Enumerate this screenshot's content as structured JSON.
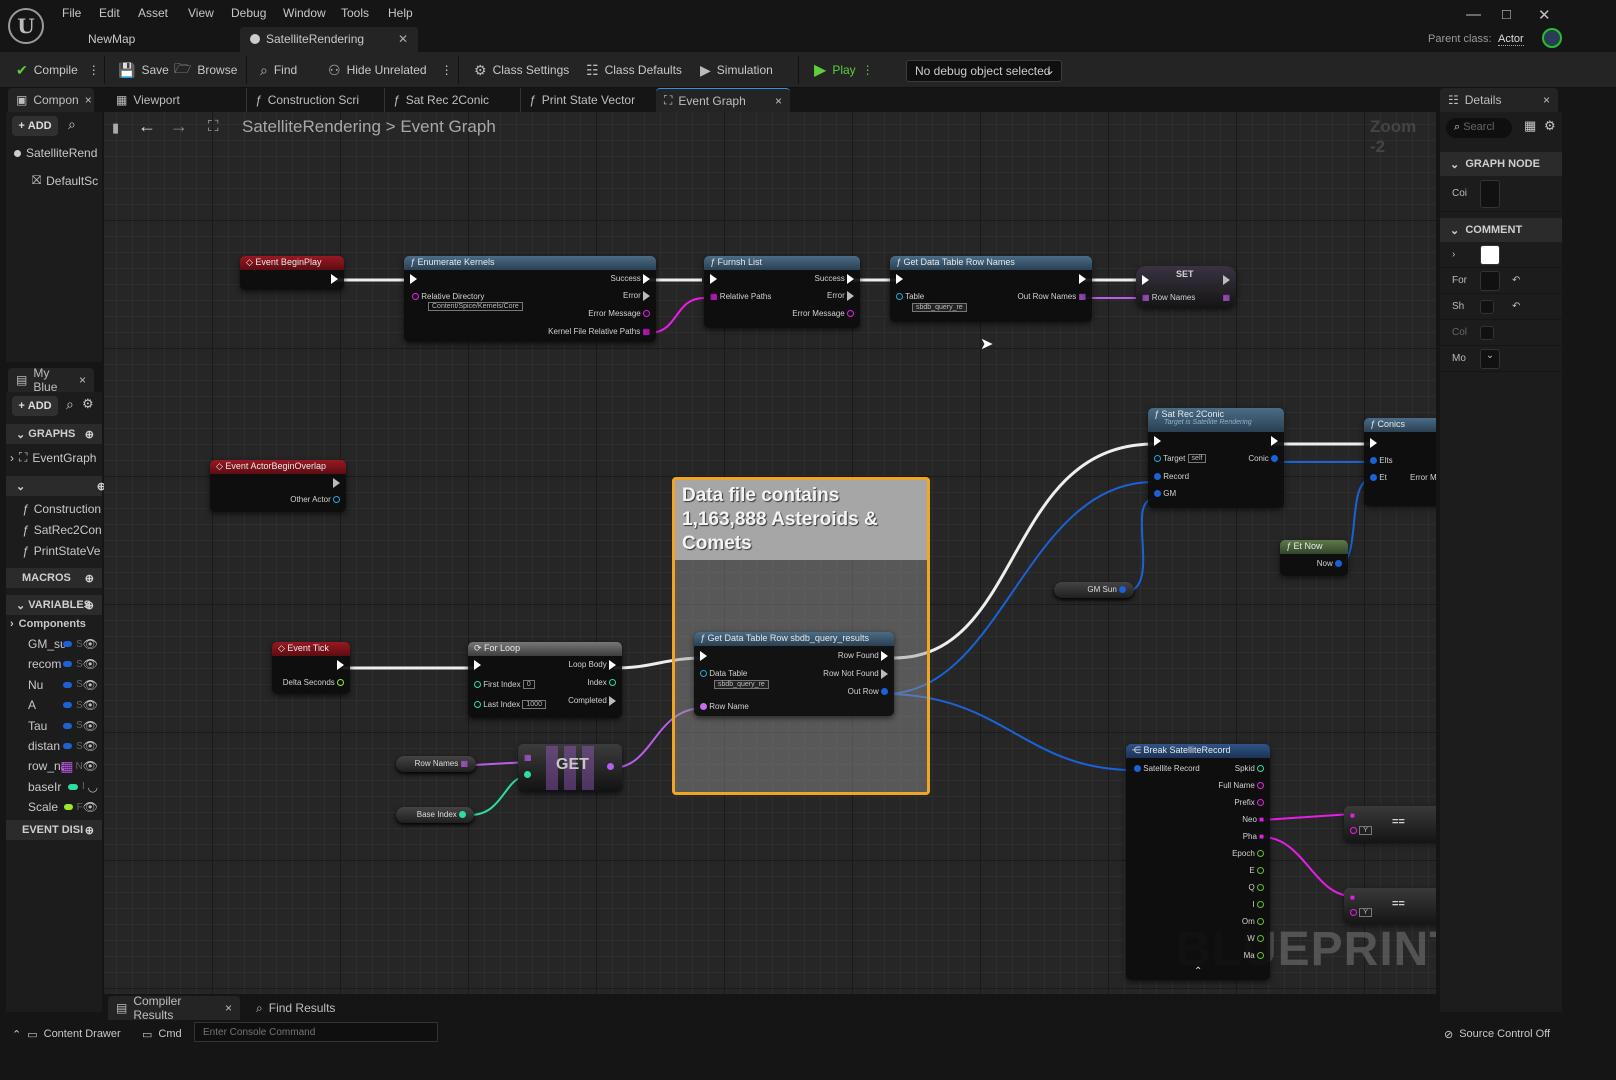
{
  "app": {
    "menu": [
      "File",
      "Edit",
      "Asset",
      "View",
      "Debug",
      "Window",
      "Tools",
      "Help"
    ],
    "doc_tabs": [
      {
        "label": "NewMap",
        "active": false
      },
      {
        "label": "SatelliteRendering",
        "active": true
      }
    ],
    "parent_class_label": "Parent class:",
    "parent_class_value": "Actor",
    "window_controls": {
      "minimize": "—",
      "maximize": "□",
      "close": "✕"
    }
  },
  "toolbar": {
    "compile": "Compile",
    "save": "Save",
    "browse": "Browse",
    "find": "Find",
    "hide_unrelated": "Hide Unrelated",
    "class_settings": "Class Settings",
    "class_defaults": "Class Defaults",
    "simulation": "Simulation",
    "play": "Play",
    "debug_object": "No debug object selected",
    "accent_play": "#5fcd3d"
  },
  "components_panel": {
    "tab": "Compon",
    "add": "ADD",
    "items": [
      "SatelliteRend",
      "DefaultSc"
    ]
  },
  "graph_tabs": [
    {
      "label": "Viewport",
      "icon": "viewport-icon"
    },
    {
      "label": "Construction Scri",
      "icon": "function-icon"
    },
    {
      "label": "Sat Rec 2Conic",
      "icon": "function-icon"
    },
    {
      "label": "Print State Vector",
      "icon": "function-icon"
    },
    {
      "label": "Event Graph",
      "icon": "graph-icon",
      "active": true
    }
  ],
  "breadcrumb": {
    "root": "SatelliteRendering",
    "sep": ">",
    "current": "Event Graph"
  },
  "zoom_label": "Zoom -2",
  "watermark": "BLUEPRINT",
  "my_blueprint": {
    "tab": "My Blue",
    "add": "ADD",
    "graphs_header": "GRAPHS",
    "graphs": [
      "EventGraph"
    ],
    "functions": [
      "Construction",
      "SatRec2Con",
      "PrintStateVe"
    ],
    "macros_header": "MACROS",
    "variables_header": "VARIABLES",
    "components_label": "Components",
    "variables": [
      {
        "name": "GM_su",
        "color": "#1b62d6",
        "type": "S",
        "visible": true
      },
      {
        "name": "recom",
        "color": "#1b62d6",
        "type": "S",
        "visible": true
      },
      {
        "name": "Nu",
        "color": "#1b62d6",
        "type": "S",
        "visible": true
      },
      {
        "name": "A",
        "color": "#1b62d6",
        "type": "S",
        "visible": true
      },
      {
        "name": "Tau",
        "color": "#1b62d6",
        "type": "S",
        "visible": true
      },
      {
        "name": "distan",
        "color": "#1b62d6",
        "type": "S",
        "visible": true
      },
      {
        "name": "row_na",
        "color": "#b44fe0",
        "type": "N",
        "visible": true,
        "array": true
      },
      {
        "name": "baseIr",
        "color": "#2bdfa0",
        "type": "I",
        "visible": false
      },
      {
        "name": "Scale",
        "color": "#9ce82f",
        "type": "F",
        "visible": true
      }
    ],
    "event_dispatchers_header": "EVENT DISI"
  },
  "nodes": {
    "event_begin_play": {
      "title": "Event BeginPlay"
    },
    "enumerate_kernels": {
      "title": "Enumerate Kernels",
      "relative_directory": "Relative Directory",
      "directory_value": "Content/Spice/Kernels/Core",
      "success": "Success",
      "error": "Error",
      "error_message": "Error Message",
      "kernel_paths": "Kernel File Relative Paths"
    },
    "furnsh_list": {
      "title": "Furnsh List",
      "relative_paths": "Relative Paths",
      "success": "Success",
      "error": "Error",
      "error_message": "Error Message"
    },
    "get_row_names": {
      "title": "Get Data Table Row Names",
      "table": "Table",
      "table_value": "sbdb_query_re",
      "out": "Out Row Names"
    },
    "set": {
      "title": "SET",
      "row_names": "Row Names"
    },
    "event_actor_overlap": {
      "title": "Event ActorBeginOverlap",
      "other_actor": "Other Actor"
    },
    "sat_rec_2conic": {
      "title": "Sat Rec 2Conic",
      "subtitle": "Target is Satellite Rendering",
      "target": "Target",
      "target_value": "self",
      "record": "Record",
      "gm": "GM",
      "conic": "Conic"
    },
    "conics": {
      "title": "Conics",
      "elts": "Elts",
      "et": "Et",
      "error": "Error M"
    },
    "et_now": {
      "title": "Et Now",
      "now": "Now"
    },
    "gm_sun": {
      "label": "GM Sun"
    },
    "event_tick": {
      "title": "Event Tick",
      "delta": "Delta Seconds"
    },
    "for_loop": {
      "title": "For Loop",
      "first_index": "First Index",
      "first_value": "0",
      "last_index": "Last Index",
      "last_value": "1000",
      "loop_body": "Loop Body",
      "index": "Index",
      "completed": "Completed"
    },
    "row_names_var": {
      "label": "Row Names"
    },
    "base_index_var": {
      "label": "Base Index"
    },
    "get": {
      "label": "GET"
    },
    "comment": {
      "text": "Data file contains 1,163,888 Asteroids & Comets"
    },
    "get_row": {
      "title": "Get Data Table Row sbdb_query_results",
      "data_table": "Data Table",
      "table_value": "sbdb_query_re",
      "row_name": "Row Name",
      "row_found": "Row Found",
      "row_not_found": "Row Not Found",
      "out_row": "Out Row"
    },
    "break_record": {
      "title": "Break SatelliteRecord",
      "input": "Satellite Record",
      "outputs": [
        "Spkid",
        "Full Name",
        "Prefix",
        "Neo",
        "Pha",
        "Epoch",
        "E",
        "Q",
        "I",
        "Om",
        "W",
        "Ma"
      ]
    },
    "equal_1": {
      "op": "==",
      "literal": "Y"
    },
    "equal_2": {
      "op": "==",
      "literal": "Y"
    }
  },
  "details": {
    "title": "Details",
    "search_placeholder": "Searcl",
    "graph_node_header": "GRAPH NODE",
    "graph_node_rows": [
      "Coi"
    ],
    "comment_header": "COMMENT",
    "comment_rows": [
      "",
      "For",
      "Sh",
      "Col",
      "Mo"
    ]
  },
  "bottom": {
    "tabs": [
      "Compiler Results",
      "Find Results"
    ],
    "content_drawer": "Content Drawer",
    "cmd": "Cmd",
    "console_placeholder": "Enter Console Command",
    "source_control": "Source Control Off"
  }
}
